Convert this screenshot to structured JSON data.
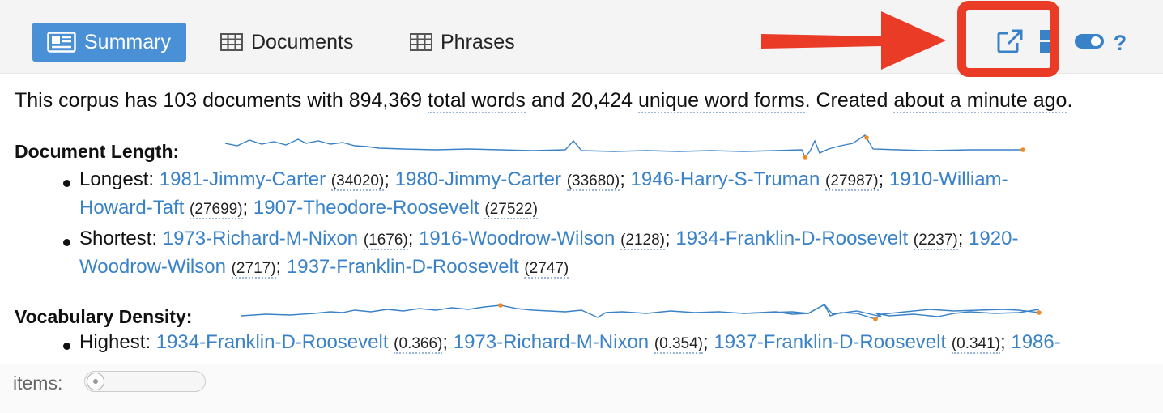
{
  "tabs": [
    {
      "label": "Summary",
      "icon": "newspaper-icon",
      "active": true
    },
    {
      "label": "Documents",
      "icon": "table-icon",
      "active": false
    },
    {
      "label": "Phrases",
      "icon": "table-icon",
      "active": false
    }
  ],
  "toolbar_icons": [
    "export-icon",
    "layout-icon",
    "toggle-icon",
    "help-icon"
  ],
  "help_label": "?",
  "colors": {
    "accent": "#4a90d6",
    "link": "#3a82c7",
    "annotation": "#ea3b26",
    "sparkline": "#3a82c7",
    "sparkline_marker": "#f08a24"
  },
  "summary": {
    "prefix": "This corpus has 103 documents with 894,369",
    "total_words": "total words",
    "mid": "and 20,424",
    "unique_forms": "unique word forms",
    "created": ". Created",
    "time": "about a minute ago",
    "end": "."
  },
  "doc_length": {
    "heading": "Document Length:",
    "longest_label": "Longest:",
    "longest": [
      {
        "name": "1981-Jimmy-Carter",
        "count": "34020"
      },
      {
        "name": "1980-Jimmy-Carter",
        "count": "33680"
      },
      {
        "name": "1946-Harry-S-Truman",
        "count": "27987"
      },
      {
        "name": "1910-William-",
        "name2": "Howard-Taft",
        "count": "27699"
      },
      {
        "name": "1907-Theodore-Roosevelt",
        "count": "27522"
      }
    ],
    "shortest_label": "Shortest:",
    "shortest": [
      {
        "name": "1973-Richard-M-Nixon",
        "count": "1676"
      },
      {
        "name": "1916-Woodrow-Wilson",
        "count": "2128"
      },
      {
        "name": "1934-Franklin-D-Roosevelt",
        "count": "2237"
      },
      {
        "name": "1920-",
        "name2": "Woodrow-Wilson",
        "count": "2717"
      },
      {
        "name": "1937-Franklin-D-Roosevelt",
        "count": "2747"
      }
    ]
  },
  "vocab_density": {
    "heading": "Vocabulary Density:",
    "highest_label": "Highest:",
    "highest": [
      {
        "name": "1934-Franklin-D-Roosevelt",
        "count": "0.366"
      },
      {
        "name": "1973-Richard-M-Nixon",
        "count": "0.354"
      },
      {
        "name": "1937-Franklin-D-Roosevelt",
        "count": "0.341"
      },
      {
        "name": "1986-"
      }
    ]
  },
  "footer": {
    "items_label": "items:"
  },
  "sep": "; ",
  "open_paren": "(",
  "close_paren": ")"
}
